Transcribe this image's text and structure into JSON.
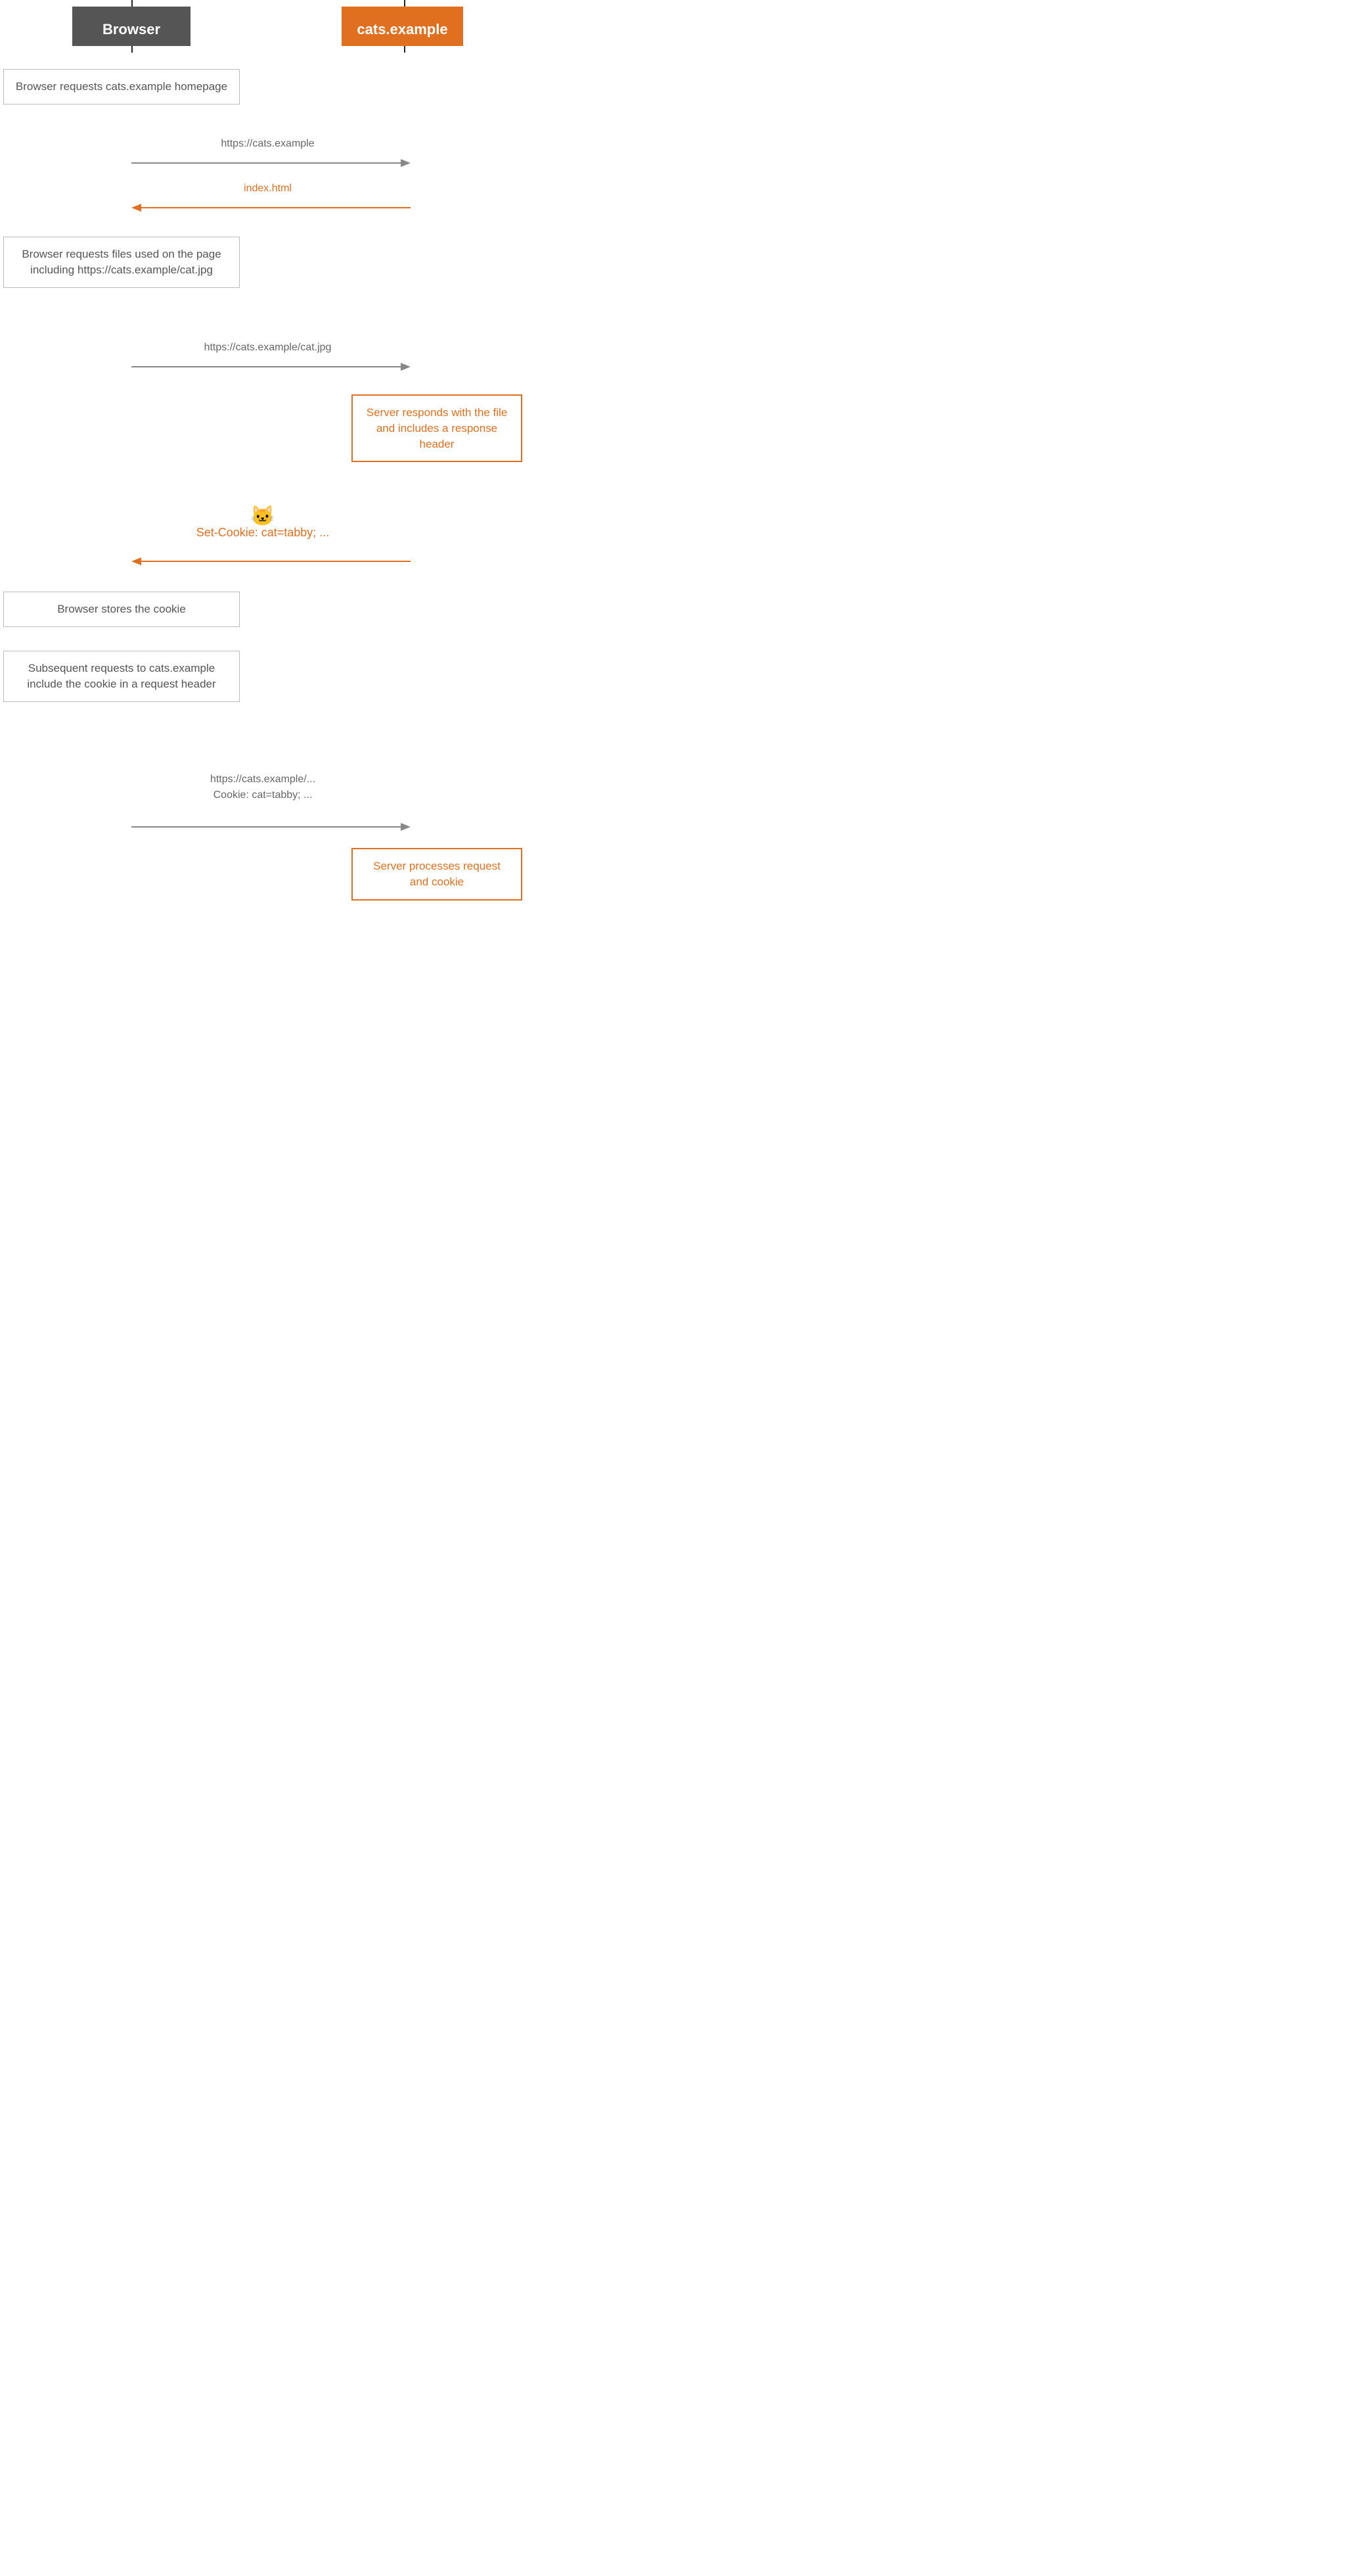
{
  "actors": {
    "browser_label": "Browser",
    "server_label": "cats.example"
  },
  "notes": {
    "n1": "Browser requests\ncats.example homepage",
    "n2": "Browser requests files\nused on the page including\nhttps://cats.example/cat.jpg",
    "n3": "Server responds with\nthe file and includes\na response header",
    "n4": "Browser stores the cookie",
    "n5": "Subsequent requests to\ncats.example include the\ncookie in a request header",
    "n6": "Server processes\nrequest and cookie"
  },
  "arrows": {
    "a1_label": "https://cats.example",
    "a2_label": "index.html",
    "a3_label": "https://cats.example/cat.jpg",
    "a4_emoji": "🐱",
    "a4_label": "Set-Cookie: cat=tabby; ...",
    "a5_line1": "https://cats.example/...",
    "a5_line2": "Cookie: cat=tabby; ..."
  },
  "colors": {
    "orange": "#e07020",
    "gray_actor": "#555555",
    "lifeline": "#222222",
    "arrow_gray": "#888888",
    "border_gray": "#bbbbbb"
  }
}
